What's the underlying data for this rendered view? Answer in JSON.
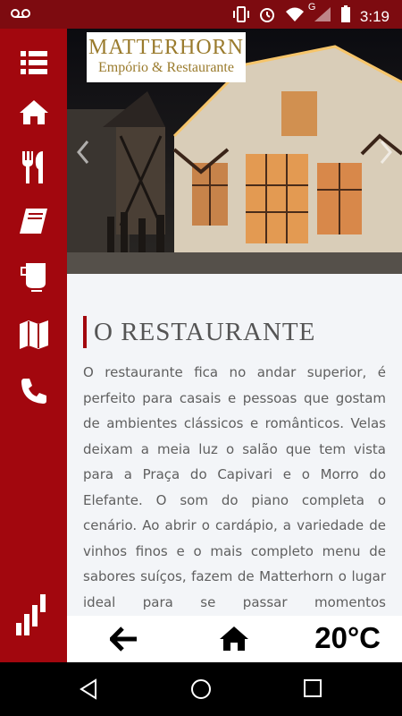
{
  "status_bar": {
    "time": "3:19",
    "network_letter": "G",
    "icons": [
      "voicemail-icon",
      "vibrate-icon",
      "alarm-icon",
      "wifi-icon",
      "signal-icon",
      "battery-icon"
    ]
  },
  "colors": {
    "primary": "#a2070e",
    "status_bar": "#7d0b10",
    "gold": "#9a7b2d",
    "content_bg": "#f3f5f8"
  },
  "sidebar": {
    "items": [
      {
        "icon": "menu-icon"
      },
      {
        "icon": "home-icon"
      },
      {
        "icon": "cutlery-icon"
      },
      {
        "icon": "book-icon"
      },
      {
        "icon": "coffee-icon"
      },
      {
        "icon": "map-icon"
      },
      {
        "icon": "phone-icon"
      }
    ],
    "footer_icon": "stairs-logo-icon"
  },
  "hero": {
    "logo_title": "MATTERHORN",
    "logo_subtitle": "Empório & Restaurante"
  },
  "content": {
    "title": "O RESTAURANTE",
    "body": "O restaurante fica no andar superior, é perfeito para casais e pessoas que gostam de ambientes clássicos e românticos. Velas deixam a meia luz o salão que tem vista para a Praça do Capivari e o Morro do Elefante. O som do piano completa o cenário. Ao abrir o cardápio, a variedade de vinhos finos e o mais completo menu de sabores suíços, fazem de Matterhorn o lugar ideal para se passar momentos inesquecíveis na serra da Mantiqueira."
  },
  "bottom_bar": {
    "temperature": "20°C"
  }
}
